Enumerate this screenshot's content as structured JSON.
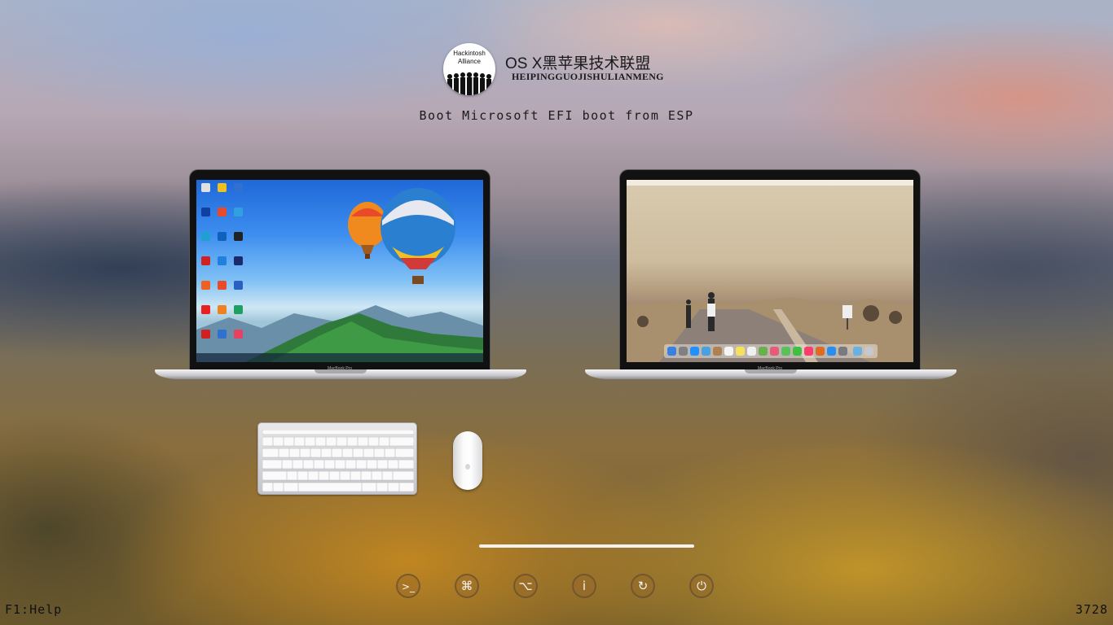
{
  "logo": {
    "text": "Hackintosh\nAlliance"
  },
  "brand": {
    "title": "OS X黑苹果技术联盟",
    "subtitle": "HEIPINGGUOJISHULIANMENG"
  },
  "boot_title": "Boot Microsoft EFI boot from ESP",
  "volumes": [
    {
      "id": "windows",
      "label": "MacBook Pro"
    },
    {
      "id": "macos",
      "label": "MacBook Pro"
    }
  ],
  "tools": [
    {
      "id": "shell",
      "glyph": ">_",
      "icon": "terminal-icon"
    },
    {
      "id": "command",
      "glyph": "⌘",
      "icon": "command-icon"
    },
    {
      "id": "option",
      "glyph": "⌥",
      "icon": "option-key-icon"
    },
    {
      "id": "about",
      "glyph": "i",
      "icon": "info-icon"
    },
    {
      "id": "restart",
      "glyph": "↻",
      "icon": "restart-icon"
    },
    {
      "id": "shutdown",
      "glyph": "⏻",
      "icon": "power-icon"
    }
  ],
  "footer": {
    "help": "F1:Help",
    "counter": "3728"
  },
  "colors": {
    "selection_bar": "#f2f2f2",
    "text": "#1b1b1b"
  }
}
